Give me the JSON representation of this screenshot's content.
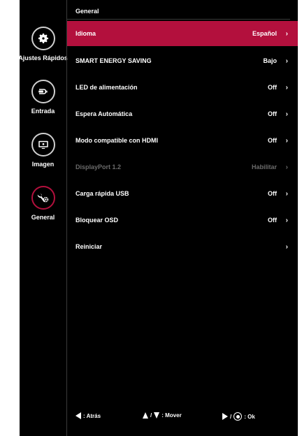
{
  "colors": {
    "background": "#000000",
    "accent": "#b3103d",
    "text": "#ffffff",
    "disabled_text": "#6b6b6b"
  },
  "sidebar": {
    "items": [
      {
        "label": "Ajustes Rápidos",
        "icon": "gear-icon",
        "active": false
      },
      {
        "label": "Entrada",
        "icon": "input-plug-icon",
        "active": false
      },
      {
        "label": "Imagen",
        "icon": "monitor-icon",
        "active": false
      },
      {
        "label": "General",
        "icon": "general-settings-icon",
        "active": true
      }
    ]
  },
  "header": {
    "title": "General"
  },
  "menu": {
    "items": [
      {
        "label": "Idioma",
        "value": "Español",
        "chevron": "›",
        "selected": true,
        "disabled": false
      },
      {
        "label": "SMART ENERGY SAVING",
        "value": "Bajo",
        "chevron": "›",
        "selected": false,
        "disabled": false
      },
      {
        "label": "LED de alimentación",
        "value": "Off",
        "chevron": "›",
        "selected": false,
        "disabled": false
      },
      {
        "label": "Espera Automática",
        "value": "Off",
        "chevron": "›",
        "selected": false,
        "disabled": false
      },
      {
        "label": "Modo compatible con HDMI",
        "value": "Off",
        "chevron": "›",
        "selected": false,
        "disabled": false
      },
      {
        "label": "DisplayPort 1.2",
        "value": "Habilitar",
        "chevron": "›",
        "selected": false,
        "disabled": true
      },
      {
        "label": "Carga rápida USB",
        "value": "Off",
        "chevron": "›",
        "selected": false,
        "disabled": false
      },
      {
        "label": "Bloquear OSD",
        "value": "Off",
        "chevron": "›",
        "selected": false,
        "disabled": false
      },
      {
        "label": "Reiniciar",
        "value": "",
        "chevron": "›",
        "selected": false,
        "disabled": false
      }
    ]
  },
  "footer": {
    "back": ": Atrás",
    "move_separator": "/",
    "move": ": Mover",
    "ok_separator": "/",
    "ok": ": Ok"
  }
}
